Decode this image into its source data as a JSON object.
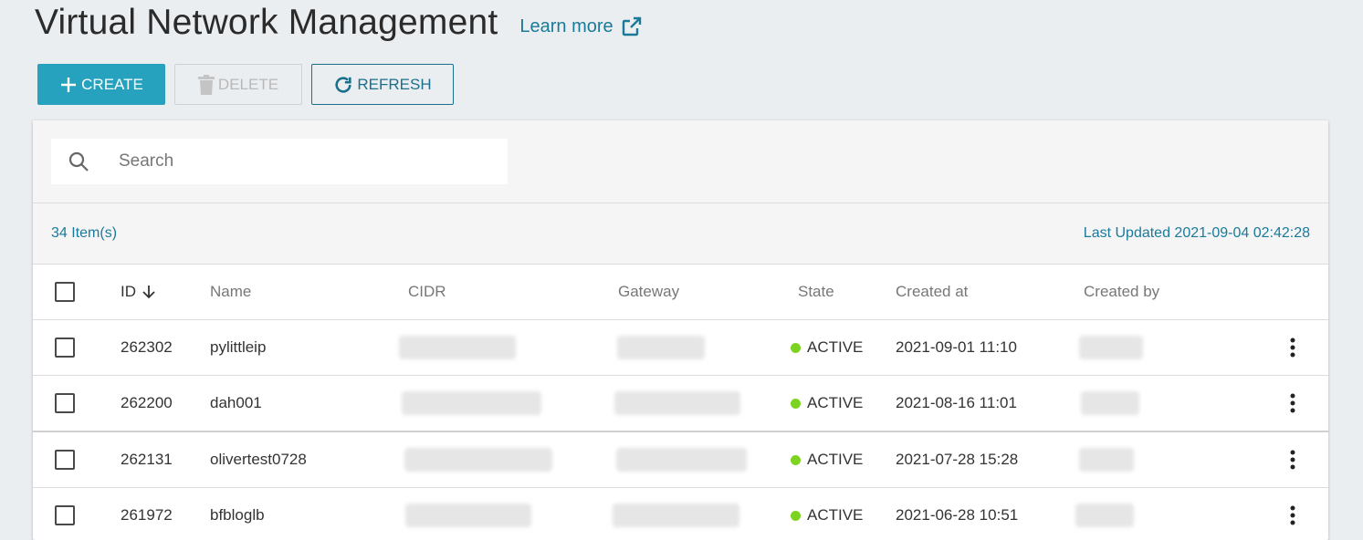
{
  "page": {
    "title": "Virtual Network Management",
    "learn_more": "Learn more"
  },
  "toolbar": {
    "create_label": "CREATE",
    "delete_label": "DELETE",
    "refresh_label": "REFRESH"
  },
  "search": {
    "placeholder": "Search",
    "value": ""
  },
  "info": {
    "item_count": "34 Item(s)",
    "last_updated": "Last Updated 2021-09-04 02:42:28"
  },
  "table": {
    "columns": {
      "id": "ID",
      "name": "Name",
      "cidr": "CIDR",
      "gateway": "Gateway",
      "state": "State",
      "created_at": "Created at",
      "created_by": "Created by"
    },
    "rows": [
      {
        "id": "262302",
        "name": "pylittleip",
        "state": "ACTIVE",
        "created_at": "2021-09-01 11:10"
      },
      {
        "id": "262200",
        "name": "dah001",
        "state": "ACTIVE",
        "created_at": "2021-08-16 11:01"
      },
      {
        "id": "262131",
        "name": "olivertest0728",
        "state": "ACTIVE",
        "created_at": "2021-07-28 15:28"
      },
      {
        "id": "261972",
        "name": "bfbloglb",
        "state": "ACTIVE",
        "created_at": "2021-06-28 10:51"
      }
    ]
  },
  "colors": {
    "accent": "#26a2bf",
    "link": "#1a7a9a",
    "status_active": "#7ed321"
  },
  "icons": {
    "create": "plus-icon",
    "delete": "trash-icon",
    "refresh": "refresh-icon",
    "learn_more": "external-link-icon",
    "search": "search-icon",
    "sort": "arrow-down-icon",
    "row_menu": "more-vertical-icon"
  }
}
